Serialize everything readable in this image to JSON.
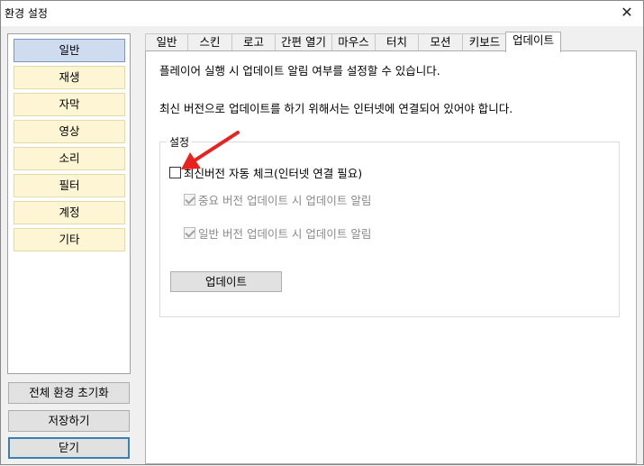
{
  "window": {
    "title": "환경 설정",
    "close_glyph": "✕"
  },
  "sidebar": {
    "items": [
      {
        "label": "일반"
      },
      {
        "label": "재생"
      },
      {
        "label": "자막"
      },
      {
        "label": "영상"
      },
      {
        "label": "소리"
      },
      {
        "label": "필터"
      },
      {
        "label": "계정"
      },
      {
        "label": "기타"
      }
    ],
    "active_index": 0
  },
  "buttons": {
    "reset_all": "전체 환경 초기화",
    "save": "저장하기",
    "close": "닫기"
  },
  "tabs": [
    {
      "label": "일반"
    },
    {
      "label": "스킨"
    },
    {
      "label": "로고"
    },
    {
      "label": "간편 열기"
    },
    {
      "label": "마우스"
    },
    {
      "label": "터치"
    },
    {
      "label": "모션"
    },
    {
      "label": "키보드"
    },
    {
      "label": "업데이트"
    }
  ],
  "active_tab": "업데이트",
  "update_panel": {
    "description1": "플레이어 실행 시 업데이트 알림 여부를 설정할 수 있습니다.",
    "description2": "최신 버전으로 업데이트를 하기 위해서는 인터넷에 연결되어 있어야 합니다.",
    "group_label": "설정",
    "auto_check": {
      "label": "최신버전 자동 체크(인터넷 연결 필요)",
      "checked": false
    },
    "major_alert": {
      "label": "중요 버전 업데이트 시 업데이트 알림",
      "checked": true,
      "disabled": true
    },
    "normal_alert": {
      "label": "일반 버전 업데이트 시 업데이트 알림",
      "checked": true,
      "disabled": true
    },
    "update_button": "업데이트"
  },
  "colors": {
    "sidebar_item_bg": "#fdf5d3",
    "sidebar_active_bg": "#cfdcef",
    "annotation_arrow": "#e8231f"
  }
}
